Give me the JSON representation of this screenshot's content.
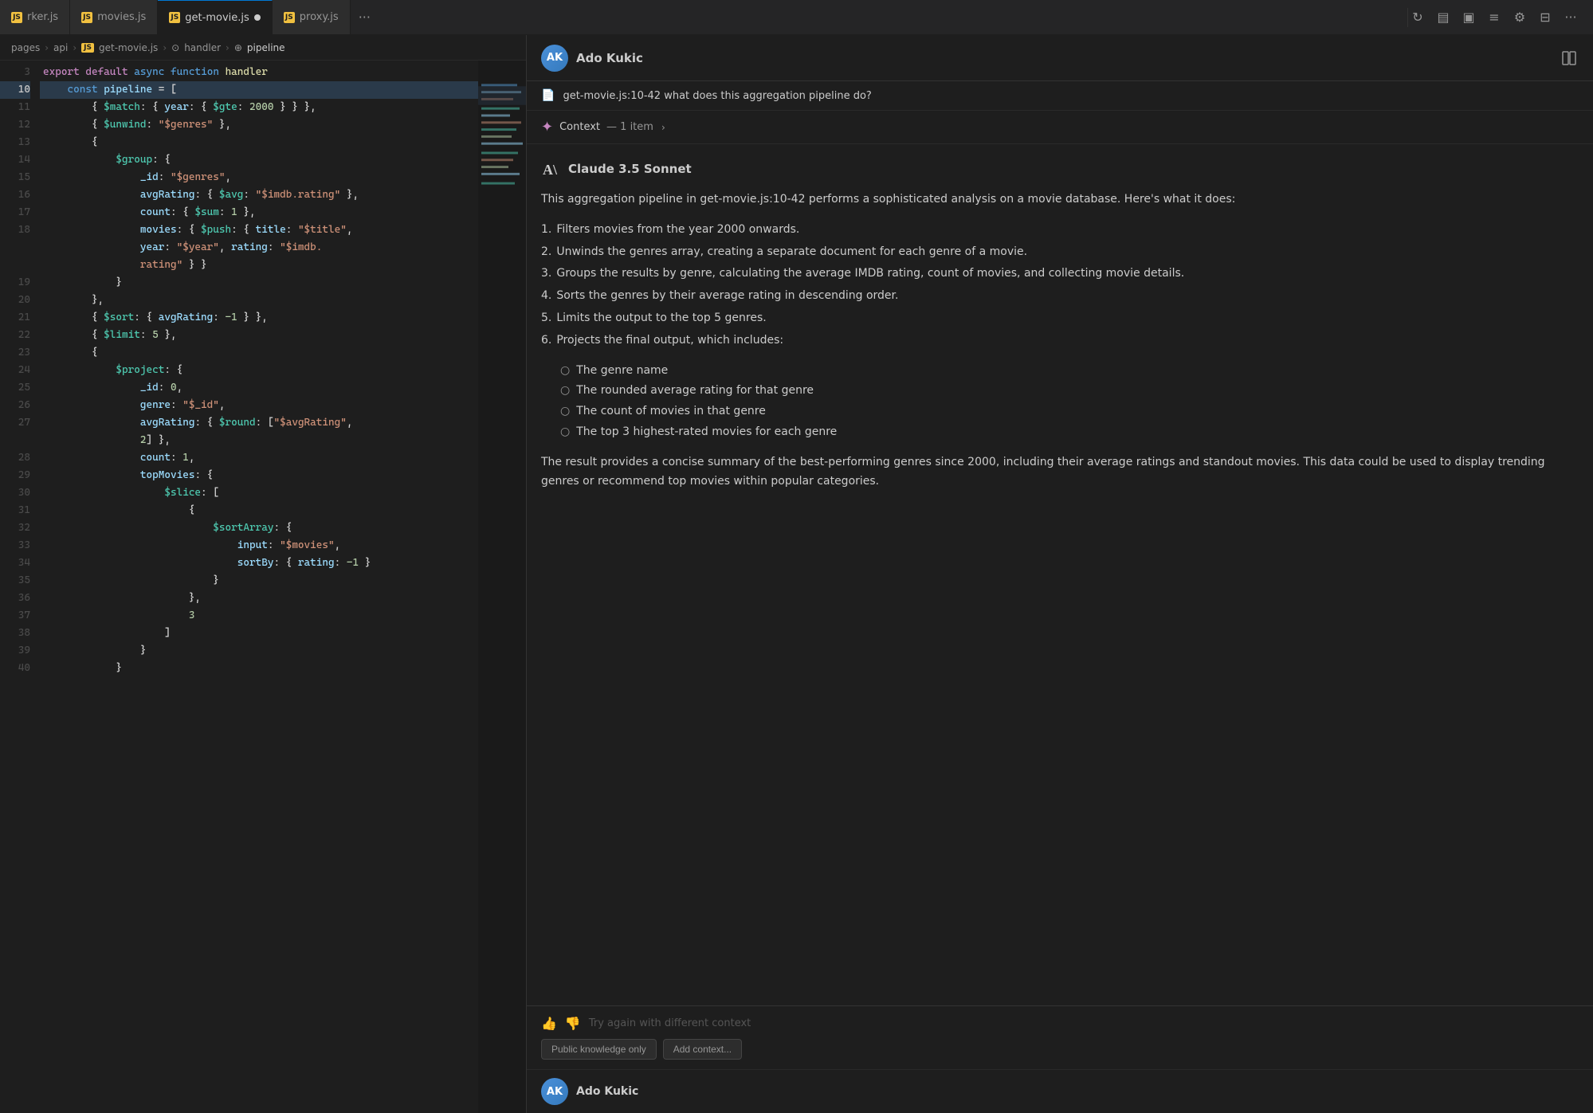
{
  "tabs": [
    {
      "id": "worker",
      "label": "rker.js",
      "icon": "JS",
      "active": false,
      "modified": false
    },
    {
      "id": "movies",
      "label": "movies.js",
      "icon": "JS",
      "active": false,
      "modified": false
    },
    {
      "id": "get-movie",
      "label": "get-movie.js",
      "icon": "JS",
      "active": true,
      "modified": true
    },
    {
      "id": "proxy",
      "label": "proxy.js",
      "icon": "JS",
      "active": false,
      "modified": false
    }
  ],
  "tab_more": "···",
  "breadcrumb": {
    "parts": [
      "pages",
      "api",
      "get-movie.js",
      "handler",
      "pipeline"
    ],
    "separators": [
      ">",
      ">",
      ">",
      ">"
    ]
  },
  "code": {
    "lines": [
      {
        "num": "3",
        "content": "export default async function handler",
        "highlighted": false
      },
      {
        "num": "10",
        "content": "    const pipeline = [",
        "highlighted": true
      },
      {
        "num": "11",
        "content": "        { $match: { year: { $gte: 2000 } } },",
        "highlighted": false
      },
      {
        "num": "12",
        "content": "        { $unwind: \"$genres\" },",
        "highlighted": false
      },
      {
        "num": "13",
        "content": "        {",
        "highlighted": false
      },
      {
        "num": "14",
        "content": "            $group: {",
        "highlighted": false
      },
      {
        "num": "15",
        "content": "                _id: \"$genres\",",
        "highlighted": false
      },
      {
        "num": "16",
        "content": "                avgRating: { $avg: \"$imdb.rating\" },",
        "highlighted": false
      },
      {
        "num": "17",
        "content": "                count: { $sum: 1 },",
        "highlighted": false
      },
      {
        "num": "18",
        "content": "                movies: { $push: { title: \"$title\",",
        "highlighted": false
      },
      {
        "num": "",
        "content": "                year: \"$year\", rating: \"$imdb.",
        "highlighted": false
      },
      {
        "num": "",
        "content": "                rating\" } }",
        "highlighted": false
      },
      {
        "num": "19",
        "content": "            }",
        "highlighted": false
      },
      {
        "num": "20",
        "content": "        },",
        "highlighted": false
      },
      {
        "num": "21",
        "content": "        { $sort: { avgRating: -1 } },",
        "highlighted": false
      },
      {
        "num": "22",
        "content": "        { $limit: 5 },",
        "highlighted": false
      },
      {
        "num": "23",
        "content": "        {",
        "highlighted": false
      },
      {
        "num": "24",
        "content": "            $project: {",
        "highlighted": false
      },
      {
        "num": "25",
        "content": "                _id: 0,",
        "highlighted": false
      },
      {
        "num": "26",
        "content": "                genre: \"$_id\",",
        "highlighted": false
      },
      {
        "num": "27",
        "content": "                avgRating: { $round: [\"$avgRating\",",
        "highlighted": false
      },
      {
        "num": "",
        "content": "                2] },",
        "highlighted": false
      },
      {
        "num": "28",
        "content": "                count: 1,",
        "highlighted": false
      },
      {
        "num": "29",
        "content": "                topMovies: {",
        "highlighted": false
      },
      {
        "num": "30",
        "content": "                    $slice: [",
        "highlighted": false
      },
      {
        "num": "31",
        "content": "                        {",
        "highlighted": false
      },
      {
        "num": "32",
        "content": "                            $sortArray: {",
        "highlighted": false
      },
      {
        "num": "33",
        "content": "                                input: \"$movies\",",
        "highlighted": false
      },
      {
        "num": "34",
        "content": "                                sortBy: { rating: -1 }",
        "highlighted": false
      },
      {
        "num": "35",
        "content": "                            }",
        "highlighted": false
      },
      {
        "num": "36",
        "content": "                        },",
        "highlighted": false
      },
      {
        "num": "37",
        "content": "                        3",
        "highlighted": false
      },
      {
        "num": "38",
        "content": "                    ]",
        "highlighted": false
      },
      {
        "num": "39",
        "content": "                }",
        "highlighted": false
      },
      {
        "num": "40",
        "content": "            }",
        "highlighted": false
      }
    ]
  },
  "chat": {
    "user": {
      "name": "Ado Kukic",
      "avatar_initials": "AK"
    },
    "query_file": "get-movie.js:10-42",
    "query_text": "get-movie.js:10-42 what does this aggregation pipeline do?",
    "context_label": "Context",
    "context_count": "— 1 item",
    "ai_model": "Claude 3.5 Sonnet",
    "response_intro": "This aggregation pipeline in get-movie.js:10-42 performs a sophisticated analysis on a movie database. Here's what it does:",
    "response_items": [
      {
        "num": "1.",
        "text": "Filters movies from the year 2000 onwards."
      },
      {
        "num": "2.",
        "text": "Unwinds the genres array, creating a separate document for each genre of a movie."
      },
      {
        "num": "3.",
        "text": "Groups the results by genre, calculating the average IMDB rating, count of movies, and collecting movie details."
      },
      {
        "num": "4.",
        "text": "Sorts the genres by their average rating in descending order."
      },
      {
        "num": "5.",
        "text": "Limits the output to the top 5 genres."
      },
      {
        "num": "6.",
        "text": "Projects the final output, which includes:"
      }
    ],
    "sub_items": [
      "The genre name",
      "The rounded average rating for that genre",
      "The count of movies in that genre",
      "The top 3 highest-rated movies for each genre"
    ],
    "response_outro": "The result provides a concise summary of the best-performing genres since 2000, including their average ratings and standout movies. This data could be used to display trending genres or recommend top movies within popular categories.",
    "try_again_placeholder": "Try again with different context",
    "btn_public": "Public knowledge only",
    "btn_add_context": "Add context...",
    "bottom_user": "Ado Kukic"
  },
  "icons": {
    "file": "📄",
    "context_star": "✦",
    "ai_logo": "A\\",
    "thumbs_up": "👍",
    "thumbs_down": "👎",
    "layout": "⊞",
    "sidebar": "▤",
    "chat_icon": "💬",
    "menu": "≡",
    "gear": "⚙",
    "columns": "⊟",
    "more": "···"
  }
}
